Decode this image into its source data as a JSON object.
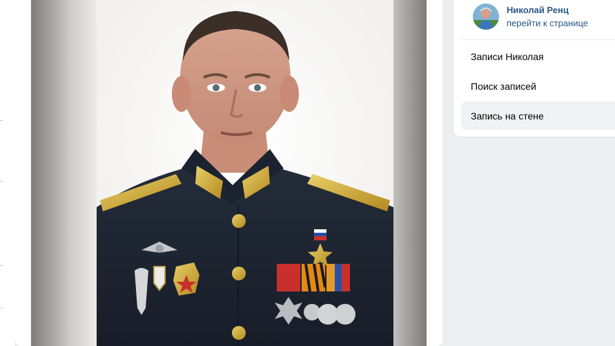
{
  "profile": {
    "name": "Николай Ренц",
    "link_label": "перейти к странице"
  },
  "menu": {
    "items": [
      {
        "label": "Записи Николая",
        "active": false
      },
      {
        "label": "Поиск записей",
        "active": false
      },
      {
        "label": "Запись на стене",
        "active": true
      }
    ]
  },
  "post": {
    "photo_description_icon": "portrait-photo"
  },
  "colors": {
    "link": "#2a5885",
    "background": "#edeef0",
    "active_item": "#f0f2f5",
    "uniform": "#1f2633",
    "gold": "#c9a227"
  }
}
